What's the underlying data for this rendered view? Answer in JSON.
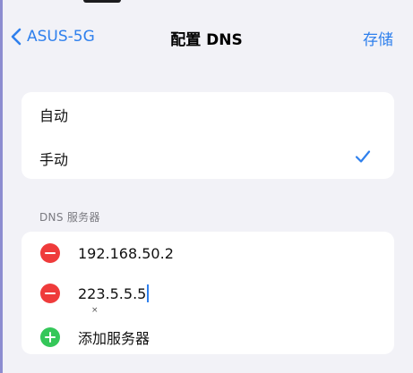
{
  "nav": {
    "back_label": "ASUS-5G",
    "title": "配置 DNS",
    "save_label": "存储"
  },
  "mode": {
    "options": [
      {
        "label": "自动",
        "selected": false
      },
      {
        "label": "手动",
        "selected": true
      }
    ]
  },
  "dns": {
    "section_header": "DNS 服务器",
    "servers": [
      "192.168.50.2",
      "223.5.5.5"
    ],
    "add_label": "添加服务器",
    "cursor_glyph": "×"
  },
  "colors": {
    "accent": "#2f80ed",
    "remove": "#ef3b3b",
    "add": "#34c759",
    "background": "#f2f2f7"
  }
}
